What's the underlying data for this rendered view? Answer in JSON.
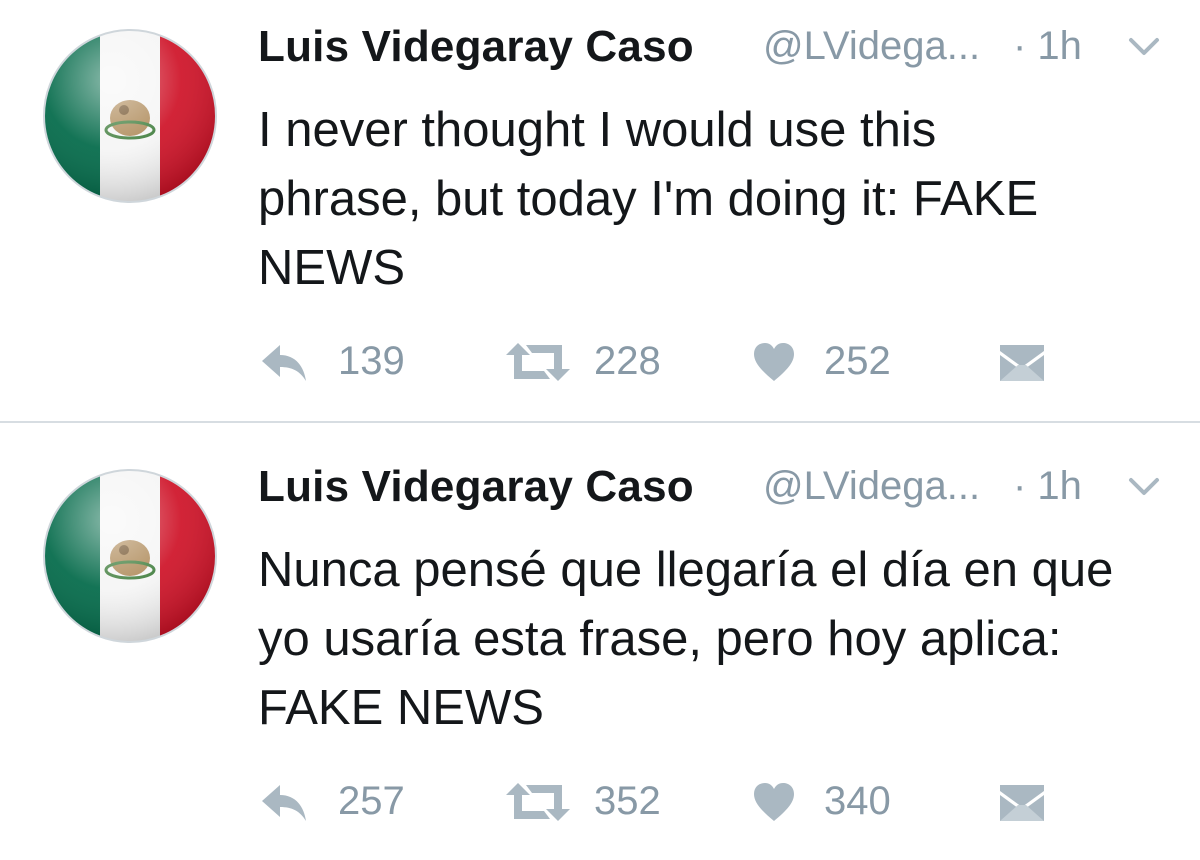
{
  "tweets": [
    {
      "author_name": "Luis Videgaray Caso",
      "author_handle": "@LVidega...",
      "time": "· 1h",
      "text_lines": [
        "I never thought I would use this",
        "phrase, but today I'm doing it: FAKE",
        "NEWS"
      ],
      "replies": "139",
      "retweets": "228",
      "likes": "252",
      "avatar_icon": "mexico-flag-icon"
    },
    {
      "author_name": "Luis Videgaray Caso",
      "author_handle": "@LVidega...",
      "time": "· 1h",
      "text_lines": [
        "Nunca pensé que llegaría el día en que",
        "yo usaría esta frase, pero hoy aplica:",
        "FAKE NEWS"
      ],
      "replies": "257",
      "retweets": "352",
      "likes": "340",
      "avatar_icon": "mexico-flag-icon"
    }
  ],
  "colors": {
    "text": "#14171a",
    "muted": "#8899a6",
    "icon": "#aab8c2",
    "flag_green": "#006847",
    "flag_red": "#ce1126",
    "divider": "#d7dde2"
  },
  "icons": {
    "reply": "reply-arrow-icon",
    "retweet": "retweet-icon",
    "like": "heart-icon",
    "dm": "envelope-icon",
    "menu": "chevron-down-icon"
  }
}
